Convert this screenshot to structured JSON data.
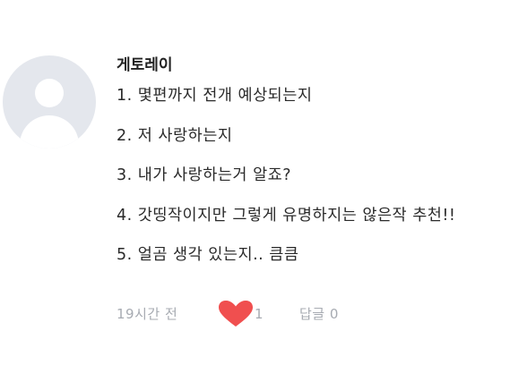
{
  "comment": {
    "author": "게토레이",
    "lines": [
      "1. 몇편까지 전개 예상되는지",
      "2. 저 사랑하는지",
      "3. 내가 사랑하는거 알죠?",
      "4. 갓띵작이지만 그렇게 유명하지는 않은작 추천!!",
      "5. 얼곰 생각 있는지.. 큼큼"
    ],
    "time": "19시간 전",
    "like_count": "1",
    "reply_label": "답글 0"
  },
  "colors": {
    "heart": "#f04f4f",
    "meta_text": "#a7abb2",
    "avatar_bg": "#e4e7ed"
  },
  "icons": {
    "avatar": "default-user-icon",
    "like": "heart-icon"
  }
}
